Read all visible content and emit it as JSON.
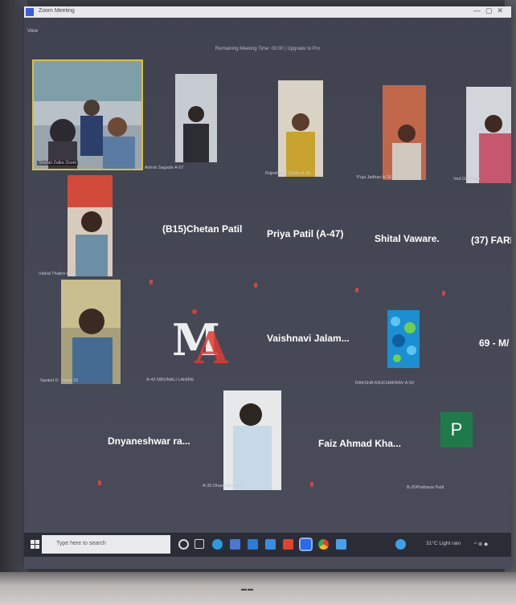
{
  "window": {
    "title": "Zoom Meeting",
    "subtitle": "View",
    "meeting_time": "Remaining Meeting Time: 00:00 | Upgrade to Pro"
  },
  "participants": [
    {
      "name_tag": "Shefali Zalke Zoom"
    },
    {
      "name_tag": "Ashok Sagade A-07"
    },
    {
      "name_tag": "Rajeshwari Dhole A-38"
    },
    {
      "name_tag": "Puja Jadhav A-26"
    },
    {
      "name_tag": "Ved Dabhade"
    },
    {
      "name_tag": "Vishal Thakre B-33"
    },
    {
      "name_big": "(B15)Chetan Patil"
    },
    {
      "name_big": "Priya  Patil (A-47)"
    },
    {
      "name_big": "Shital Vaware."
    },
    {
      "name_big": "(37) FARI"
    },
    {
      "name_tag": "Sanket D. Fulari 20"
    },
    {
      "name_tag": "A-42 MRUNALI LAHIRE",
      "logo_text": "MA"
    },
    {
      "name_big": "Vaishnavi  Jalam..."
    },
    {
      "name_tag": "RAKSHA RAJCHAKRAV A-50"
    },
    {
      "name_big": "69 - M/"
    },
    {
      "name_big": "Dnyaneshwar  ra..."
    },
    {
      "name_tag": "A-35 Dhananjay B11"
    },
    {
      "name_big": "Faiz Ahmad Kha..."
    },
    {
      "name_tag": "B-20Prathana Patil",
      "avatar_letter": "P"
    }
  ],
  "taskbar": {
    "search_placeholder": "Type here to search",
    "weather": "31°C  Light rain",
    "tray_symbols": "^  ⊕  ◆"
  },
  "colors": {
    "highlight": "#d8c23e",
    "screen_bg": "#434653",
    "avatar_green": "#1f7a4b"
  }
}
